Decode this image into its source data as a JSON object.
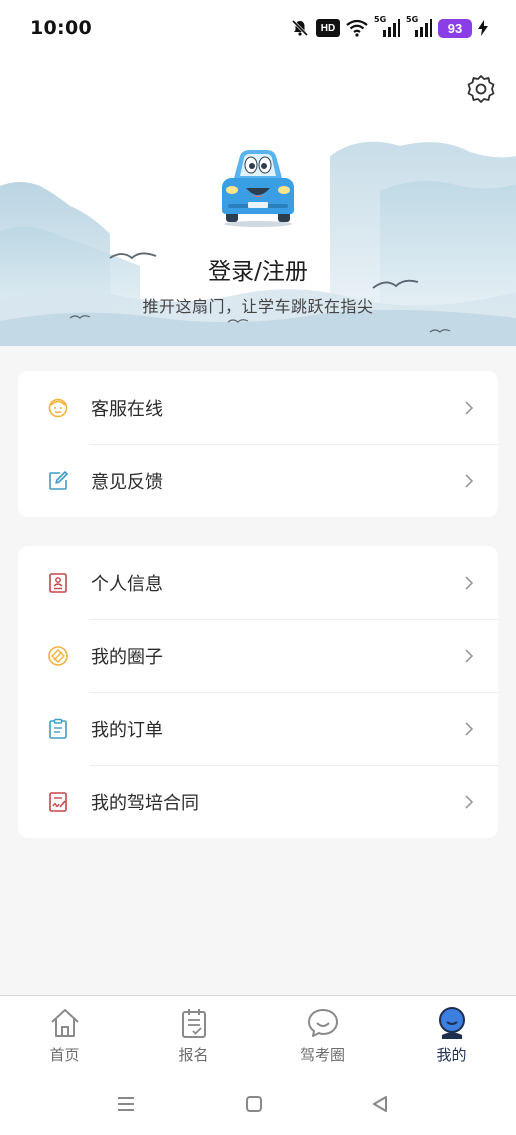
{
  "status_bar": {
    "time": "10:00",
    "hd_label": "HD",
    "network_1": "5G",
    "network_2": "5G",
    "battery": "93",
    "icons": [
      "mute-icon",
      "wifi-icon",
      "signal-icon",
      "signal-icon",
      "charging-icon"
    ]
  },
  "header": {
    "settings_icon": "gear-icon",
    "avatar_icon": "car-mascot",
    "login_title": "登录/注册",
    "login_subtitle": "推开这扇门，让学车跳跃在指尖"
  },
  "menu_group_1": [
    {
      "label": "客服在线",
      "icon": "customer-service-icon",
      "color": "#f2b33d"
    },
    {
      "label": "意见反馈",
      "icon": "edit-feedback-icon",
      "color": "#3e9cc9"
    }
  ],
  "menu_group_2": [
    {
      "label": "个人信息",
      "icon": "profile-card-icon",
      "color": "#c6464a"
    },
    {
      "label": "我的圈子",
      "icon": "circle-community-icon",
      "color": "#f2b33d"
    },
    {
      "label": "我的订单",
      "icon": "clipboard-order-icon",
      "color": "#3e9cc9"
    },
    {
      "label": "我的驾培合同",
      "icon": "contract-sign-icon",
      "color": "#c6464a"
    }
  ],
  "bottom_nav": [
    {
      "label": "首页",
      "icon": "home-icon",
      "active": false
    },
    {
      "label": "报名",
      "icon": "signup-clipboard-icon",
      "active": false
    },
    {
      "label": "驾考圈",
      "icon": "chat-bubble-icon",
      "active": false
    },
    {
      "label": "我的",
      "icon": "person-icon",
      "active": true
    }
  ],
  "colors": {
    "accent_dark": "#1f2f50",
    "active_icon": "#3d7fe0",
    "inactive": "#6d6d6d",
    "battery": "#8b3ee6"
  }
}
